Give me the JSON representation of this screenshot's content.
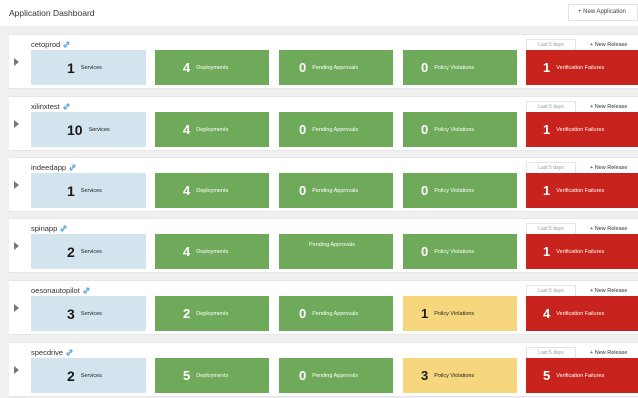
{
  "header": {
    "title": "Application Dashboard",
    "new_application_label": "+ New Application"
  },
  "labels": {
    "services": "Services",
    "deployments": "Deployments",
    "pending_approvals": "Pending Approvals",
    "policy_violations": "Policy Violations",
    "verification_failures": "Verification Failures",
    "period": "Last 5 days",
    "new_release": "+ New Release"
  },
  "colors": {
    "services": "#d3e4ee",
    "ok": "#6faa5b",
    "warning": "#f6d77e",
    "failure": "#c8231c",
    "link": "#4a9fd8"
  },
  "applications": [
    {
      "name": "cetoprod",
      "services": "1",
      "deployments": "4",
      "pending_approvals": "0",
      "policy_violations": "0",
      "policy_status": "ok",
      "verification_failures": "1"
    },
    {
      "name": "xilinxtest",
      "services": "10",
      "deployments": "4",
      "pending_approvals": "0",
      "policy_violations": "0",
      "policy_status": "ok",
      "verification_failures": "1"
    },
    {
      "name": "indeedapp",
      "services": "1",
      "deployments": "4",
      "pending_approvals": "0",
      "policy_violations": "0",
      "policy_status": "ok",
      "verification_failures": "1"
    },
    {
      "name": "spinapp",
      "services": "2",
      "deployments": "4",
      "pending_approvals": "",
      "policy_violations": "0",
      "policy_status": "ok",
      "verification_failures": "1"
    },
    {
      "name": "oesonautopilot",
      "services": "3",
      "deployments": "2",
      "pending_approvals": "0",
      "policy_violations": "1",
      "policy_status": "warning",
      "verification_failures": "4"
    },
    {
      "name": "specdrive",
      "services": "2",
      "deployments": "5",
      "pending_approvals": "0",
      "policy_violations": "3",
      "policy_status": "warning",
      "verification_failures": "5"
    }
  ]
}
